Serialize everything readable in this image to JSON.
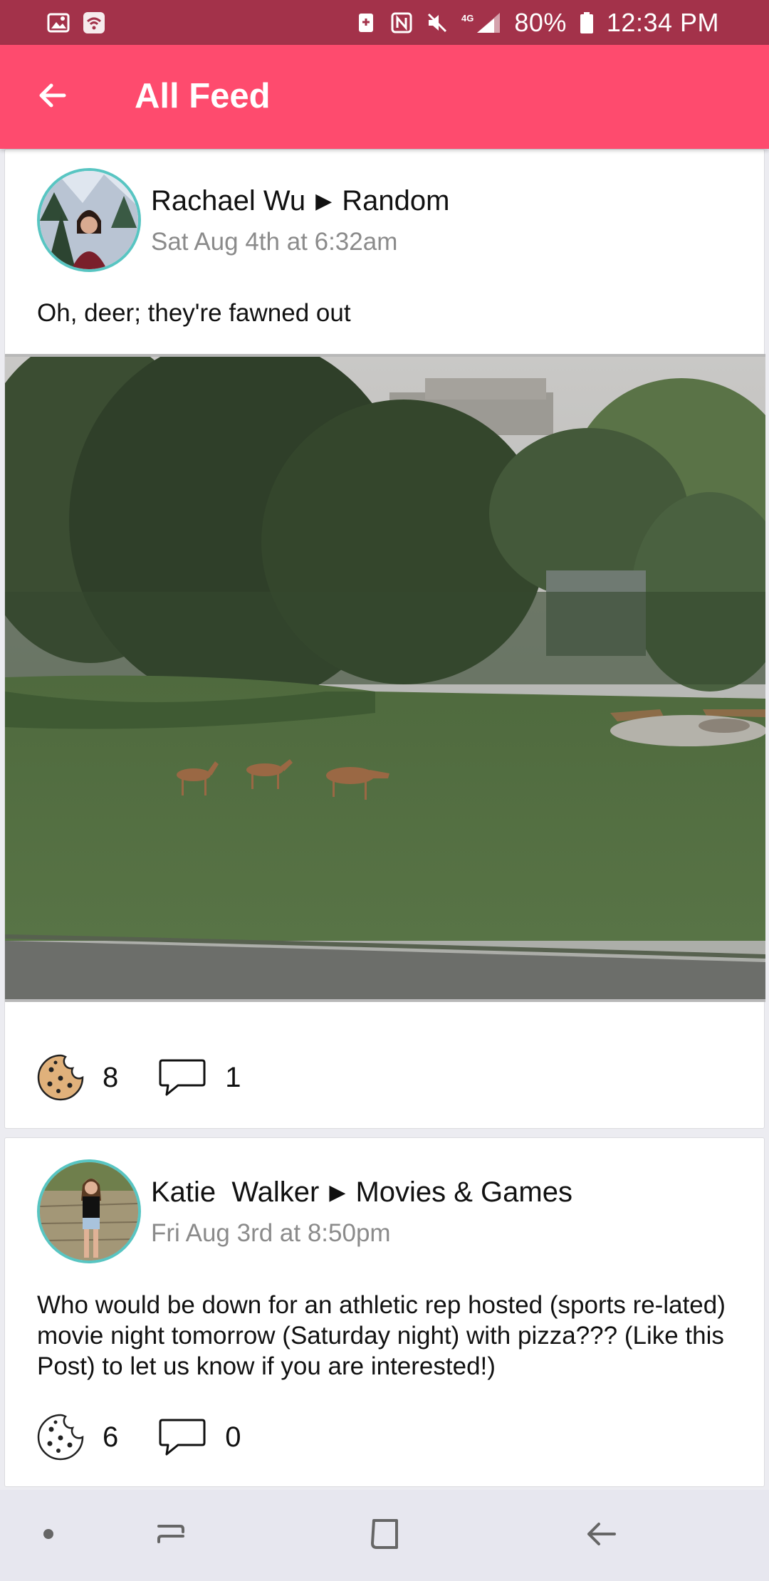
{
  "status_bar": {
    "battery_percent": "80%",
    "time": "12:34 PM",
    "icons": [
      "image-icon",
      "wifi-icon",
      "nfc-icon",
      "mute-icon",
      "lte-signal-icon",
      "battery-icon"
    ]
  },
  "app_bar": {
    "title": "All Feed",
    "back_icon": "arrow-left-icon",
    "color": "#fe4b6e"
  },
  "posts": [
    {
      "author": "Rachael Wu",
      "channel": "Random",
      "time": "Sat Aug 4th at 6:32am",
      "body": "Oh, deer; they're fawned out",
      "has_photo": true,
      "cookies": "8",
      "comments": "1",
      "cookie_icon": "cookie-filled-icon",
      "comment_icon": "comment-bubble-icon"
    },
    {
      "author": "Katie  Walker",
      "channel": "Movies & Games",
      "time": "Fri Aug 3rd at 8:50pm",
      "body": "Who would be down for an athletic rep hosted (sports re-lated) movie night tomorrow (Saturday night) with pizza??? (Like this Post) to let us know if you are interested!)",
      "has_photo": false,
      "cookies": "6",
      "comments": "0",
      "cookie_icon": "cookie-outline-icon",
      "comment_icon": "comment-bubble-icon"
    }
  ],
  "nav_bar": {
    "icons": [
      "dot-icon",
      "recents-icon",
      "home-icon",
      "back-icon"
    ]
  },
  "colors": {
    "status_bar": "#a3324a",
    "accent": "#fe4b6e",
    "avatar_ring": "#58c5c2"
  }
}
